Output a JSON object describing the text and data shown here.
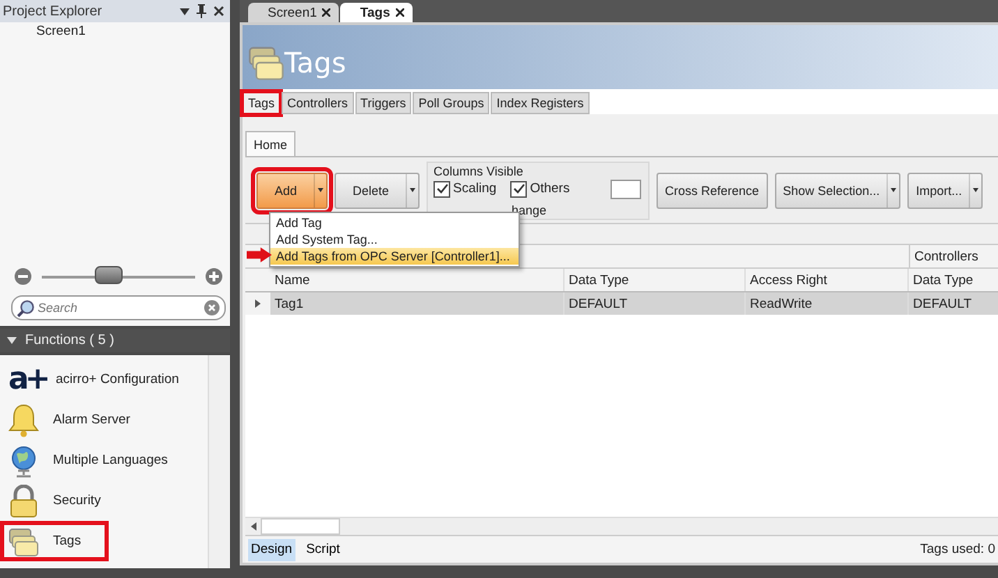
{
  "project_explorer": {
    "title": "Project Explorer",
    "tree": [
      {
        "label": "Screen1"
      }
    ],
    "zoom": {
      "level": 0.42
    },
    "search": {
      "placeholder": "Search"
    }
  },
  "functions": {
    "title": "Functions ( 5 )",
    "items": [
      {
        "label": "acirro+ Configuration",
        "kind": "logo",
        "logo": "a+",
        "annotated": false
      },
      {
        "label": "Alarm Server",
        "kind": "bell",
        "annotated": false
      },
      {
        "label": "Multiple Languages",
        "kind": "globe",
        "annotated": false
      },
      {
        "label": "Security",
        "kind": "padlock",
        "annotated": false
      },
      {
        "label": "Tags",
        "kind": "folders",
        "annotated": true
      }
    ]
  },
  "document_tabs": [
    {
      "label": "Screen1",
      "selected": false
    },
    {
      "label": "Tags",
      "selected": true
    }
  ],
  "page": {
    "title": "Tags"
  },
  "tabs": [
    {
      "label": "Tags",
      "selected": true,
      "annotated": true
    },
    {
      "label": "Controllers",
      "selected": false,
      "annotated": false
    },
    {
      "label": "Triggers",
      "selected": false,
      "annotated": false
    },
    {
      "label": "Poll Groups",
      "selected": false,
      "annotated": false
    },
    {
      "label": "Index Registers",
      "selected": false,
      "annotated": false
    }
  ],
  "ribbon": {
    "tabs": [
      {
        "label": "Home",
        "selected": true
      }
    ],
    "left_buttons": [
      {
        "label": "Add",
        "kind": "split",
        "pressed": true,
        "annotated": true
      },
      {
        "label": "Delete",
        "kind": "split",
        "pressed": false,
        "annotated": false
      }
    ],
    "columns_visible": {
      "title": "Columns Visible",
      "options": [
        {
          "label": "Scaling",
          "checked": true
        },
        {
          "label": "Others",
          "checked": true
        }
      ],
      "covered_label": "hange"
    },
    "right_buttons": [
      {
        "label": "Cross Reference",
        "kind": "plain"
      },
      {
        "label": "Show Selection...",
        "kind": "split"
      },
      {
        "label": "Import...",
        "kind": "split"
      }
    ]
  },
  "add_menu": {
    "items": [
      {
        "label": "Add Tag",
        "highlighted": false,
        "pointer_arrow": false
      },
      {
        "label": "Add System Tag...",
        "highlighted": false,
        "pointer_arrow": false
      },
      {
        "label": "Add Tags from OPC Server [Controller1]...",
        "highlighted": true,
        "pointer_arrow": true
      }
    ]
  },
  "grid": {
    "group_header": "Controllers",
    "columns": [
      "Name",
      "Data Type",
      "Access Right",
      "Data Type"
    ],
    "rows": [
      {
        "selected": true,
        "cells": [
          "Tag1",
          "DEFAULT",
          "ReadWrite",
          "DEFAULT"
        ]
      }
    ]
  },
  "footer": {
    "view_tabs": [
      {
        "label": "Design",
        "selected": true
      },
      {
        "label": "Script",
        "selected": false
      }
    ],
    "status": "Tags used: 0"
  }
}
